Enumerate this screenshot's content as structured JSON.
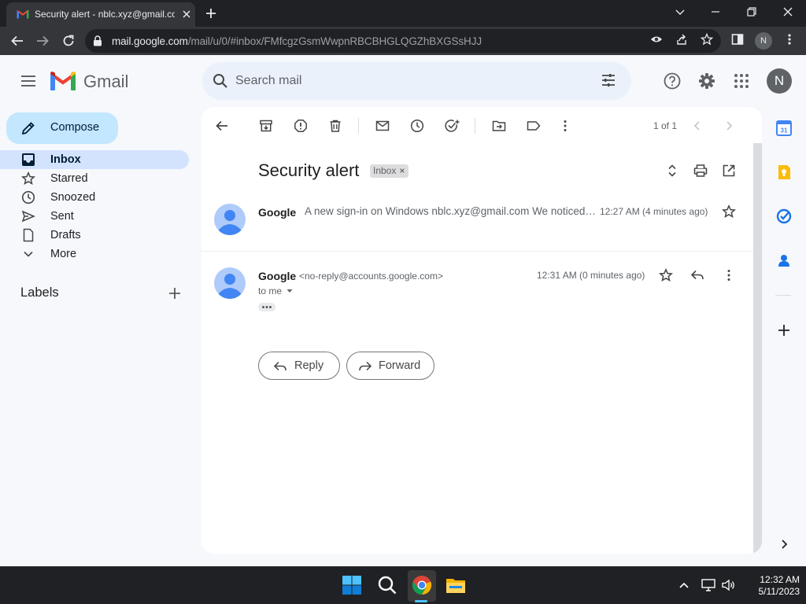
{
  "browser": {
    "tab_title": "Security alert - nblc.xyz@gmail.com - Gmail",
    "url_domain": "mail.google.com",
    "url_path": "/mail/u/0/#inbox/FMfcgzGsmWwpnRBCBHGLQGZhBXGSsHJJ",
    "profile_initial": "N"
  },
  "gmail": {
    "wordmark": "Gmail",
    "search_placeholder": "Search mail",
    "avatar_initial": "N",
    "compose_label": "Compose",
    "nav": [
      {
        "label": "Inbox",
        "active": true
      },
      {
        "label": "Starred"
      },
      {
        "label": "Snoozed"
      },
      {
        "label": "Sent"
      },
      {
        "label": "Drafts"
      },
      {
        "label": "More"
      }
    ],
    "labels_title": "Labels"
  },
  "thread": {
    "pager": "1 of 1",
    "subject": "Security alert",
    "label_chip": "Inbox",
    "label_chip_remove": "×",
    "messages": [
      {
        "sender": "Google",
        "snippet": "A new sign-in on Windows nblc.xyz@gmail.com We noticed a new sign-in to your Google Account",
        "time": "12:27 AM (4 minutes ago)"
      },
      {
        "sender": "Google",
        "sender_email": "<no-reply@accounts.google.com>",
        "time": "12:31 AM (0 minutes ago)",
        "recipient": "to me"
      }
    ],
    "reply_label": "Reply",
    "forward_label": "Forward"
  },
  "taskbar": {
    "time": "12:32 AM",
    "date": "5/11/2023"
  },
  "colors": {
    "accent_active_nav": "#d3e3fd",
    "compose_bg": "#c2e7ff",
    "search_bg": "#eaf1fb",
    "page_bg": "#f6f8fc",
    "chrome_dark": "#202124"
  }
}
